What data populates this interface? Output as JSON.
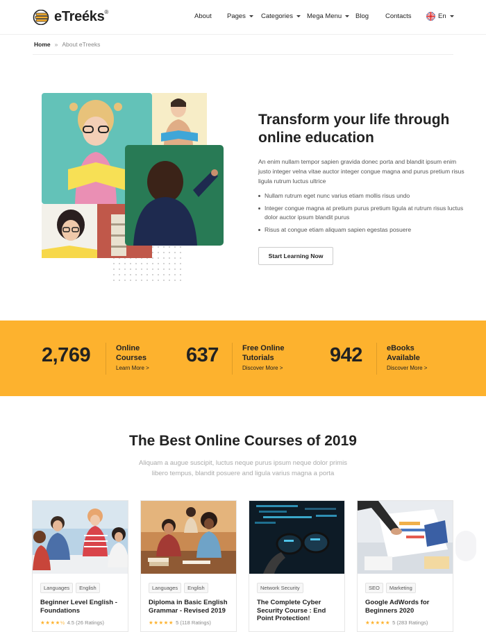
{
  "header": {
    "logo": "eTreéks",
    "logo_mark": "®",
    "nav": [
      {
        "label": "About",
        "dropdown": false
      },
      {
        "label": "Pages",
        "dropdown": true
      },
      {
        "label": "Categories",
        "dropdown": true
      },
      {
        "label": "Mega Menu",
        "dropdown": true
      },
      {
        "label": "Blog",
        "dropdown": false
      },
      {
        "label": "Contacts",
        "dropdown": false
      }
    ],
    "language": "En"
  },
  "breadcrumb": {
    "home": "Home",
    "separator": "»",
    "current": "About eTreeks"
  },
  "hero": {
    "title": "Transform your life through online education",
    "description": "An enim nullam tempor sapien gravida donec porta and blandit ipsum enim justo integer velna vitae auctor integer congue magna and purus pretium risus ligula rutrum luctus ultrice",
    "bullets": [
      "Nullam rutrum eget nunc varius etiam mollis risus undo",
      "Integer congue magna at pretium purus pretium ligula at rutrum risus luctus dolor auctor ipsum blandit purus",
      "Risus at congue etiam aliquam sapien egestas posuere"
    ],
    "button": "Start Learning Now"
  },
  "stats": [
    {
      "number": "2,769",
      "label_1": "Online",
      "label_2": "Courses",
      "link": "Learn More >"
    },
    {
      "number": "637",
      "label_1": "Free Online",
      "label_2": "Tutorials",
      "link": "Discover More >"
    },
    {
      "number": "942",
      "label_1": "eBooks",
      "label_2": "Available",
      "link": "Discover More >"
    }
  ],
  "courses": {
    "title": "The Best Online Courses of 2019",
    "subtitle": "Aliquam a augue suscipit, luctus neque purus ipsum neque dolor primis libero tempus, blandit posuere and ligula varius magna a porta",
    "cards": [
      {
        "tags": [
          "Languages",
          "English"
        ],
        "title": "Beginner Level English - Foundations",
        "stars": "★★★★½",
        "rating": "4.5 (26 Ratings)"
      },
      {
        "tags": [
          "Languages",
          "English"
        ],
        "title": "Diploma in Basic English Grammar - Revised 2019",
        "stars": "★★★★★",
        "rating": "5 (118 Ratings)"
      },
      {
        "tags": [
          "Network Security"
        ],
        "title": "The Complete Cyber Security Course : End Point Protection!",
        "stars": "",
        "rating": ""
      },
      {
        "tags": [
          "SEO",
          "Marketing"
        ],
        "title": "Google AdWords for Beginners 2020",
        "stars": "★★★★★",
        "rating": "5 (283 Ratings)"
      }
    ]
  },
  "colors": {
    "accent": "#fdb22e",
    "text": "#222222",
    "muted": "#555555"
  },
  "icons": [
    "logo-books-icon",
    "uk-flag-icon",
    "chevron-down-icon",
    "star-icon"
  ]
}
